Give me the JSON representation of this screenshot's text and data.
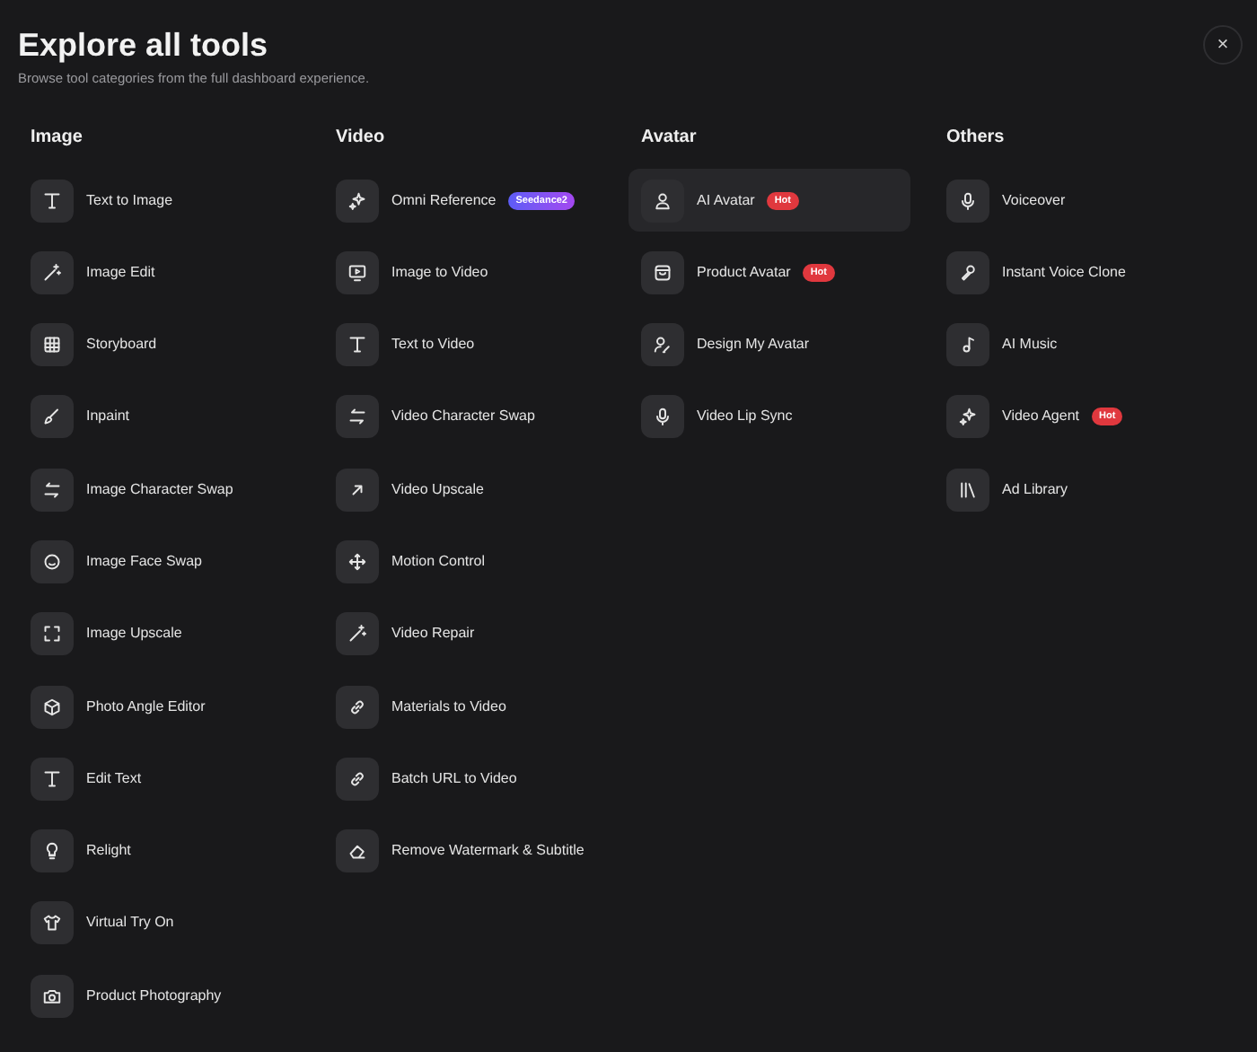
{
  "dialog": {
    "title": "Explore all tools",
    "subtitle": "Browse tool categories from the full dashboard experience.",
    "close": "×"
  },
  "categories": [
    {
      "title": "Image",
      "items": [
        {
          "label": "Text to Image",
          "highlighted": false
        },
        {
          "label": "Image Edit",
          "highlighted": false
        },
        {
          "label": "Storyboard",
          "highlighted": false
        },
        {
          "label": "Inpaint",
          "highlighted": false
        },
        {
          "label": "Image Character Swap",
          "highlighted": false
        },
        {
          "label": "Image Face Swap",
          "highlighted": false
        },
        {
          "label": "Image Upscale",
          "highlighted": false
        },
        {
          "label": "Photo Angle Editor",
          "highlighted": false
        },
        {
          "label": "Edit Text",
          "highlighted": false
        },
        {
          "label": "Relight",
          "highlighted": false
        },
        {
          "label": "Virtual Try On",
          "highlighted": false
        },
        {
          "label": "Product Photography",
          "highlighted": false
        }
      ]
    },
    {
      "title": "Video",
      "items": [
        {
          "label": "Omni Reference",
          "highlighted": false,
          "badge": {
            "text": "Seedance2",
            "kind": "new"
          }
        },
        {
          "label": "Image to Video",
          "highlighted": false
        },
        {
          "label": "Text to Video",
          "highlighted": false
        },
        {
          "label": "Video Character Swap",
          "highlighted": false
        },
        {
          "label": "Video Upscale",
          "highlighted": false
        },
        {
          "label": "Motion Control",
          "highlighted": false
        },
        {
          "label": "Video Repair",
          "highlighted": false
        },
        {
          "label": "Materials to Video",
          "highlighted": false
        },
        {
          "label": "Batch URL to Video",
          "highlighted": false
        },
        {
          "label": "Remove Watermark & Subtitle",
          "highlighted": false
        }
      ]
    },
    {
      "title": "Avatar",
      "items": [
        {
          "label": "AI Avatar",
          "highlighted": true,
          "badge": {
            "text": "Hot",
            "kind": "hot"
          }
        },
        {
          "label": "Product Avatar",
          "highlighted": false,
          "badge": {
            "text": "Hot",
            "kind": "hot"
          }
        },
        {
          "label": "Design My Avatar",
          "highlighted": false
        },
        {
          "label": "Video Lip Sync",
          "highlighted": false
        }
      ]
    },
    {
      "title": "Others",
      "items": [
        {
          "label": "Voiceover",
          "highlighted": false
        },
        {
          "label": "Instant Voice Clone",
          "highlighted": false
        },
        {
          "label": "AI Music",
          "highlighted": false
        },
        {
          "label": "Video Agent",
          "highlighted": false,
          "badge": {
            "text": "Hot",
            "kind": "hot"
          }
        },
        {
          "label": "Ad Library",
          "highlighted": false
        }
      ]
    }
  ]
}
